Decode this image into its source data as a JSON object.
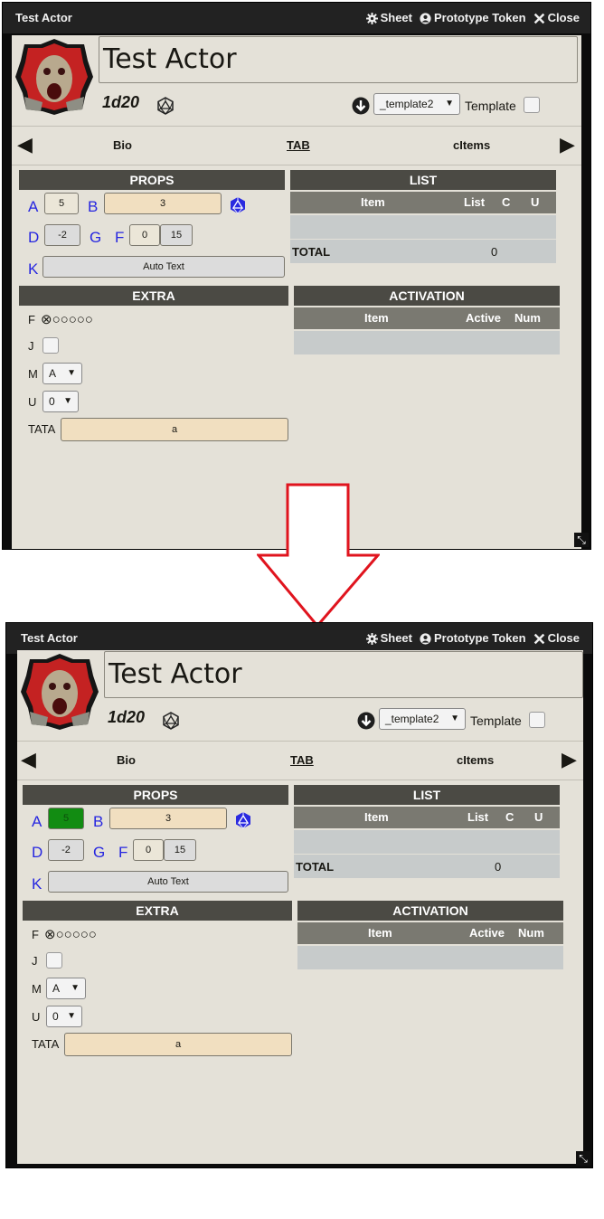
{
  "window": {
    "title": "Test Actor",
    "controls": [
      "Sheet",
      "Prototype Token",
      "Close"
    ]
  },
  "actor": {
    "name": "Test Actor",
    "formula": "1d20"
  },
  "template": {
    "selected": "_template2",
    "label": "Template"
  },
  "tabs": {
    "left": "Bio",
    "middle": "TAB",
    "right": "cItems"
  },
  "props": {
    "header": "PROPS",
    "labels": {
      "a": "A",
      "b": "B",
      "d": "D",
      "g": "G",
      "f": "F",
      "k": "K"
    },
    "a_value": "5",
    "b_value": "3",
    "d_value": "-2",
    "f_value_1": "0",
    "f_value_2": "15",
    "k_value": "Auto Text"
  },
  "list": {
    "header": "LIST",
    "columns": [
      "Item",
      "List",
      "C",
      "U"
    ],
    "total_label": "TOTAL",
    "total_value": "0"
  },
  "extra": {
    "header": "EXTRA",
    "f_label": "F",
    "f_circles": "⊗○○○○○",
    "j_label": "J",
    "m_label": "M",
    "m_value": "A",
    "u_label": "U",
    "u_value": "0",
    "tata_label": "TATA",
    "tata_value": "a"
  },
  "activation": {
    "header": "ACTIVATION",
    "columns": [
      "Item",
      "Active",
      "Num"
    ]
  },
  "colors": {
    "blue_label": "#2626e0",
    "a_field_highlight": "#128c12",
    "flow_arrow": "#e0141e"
  }
}
